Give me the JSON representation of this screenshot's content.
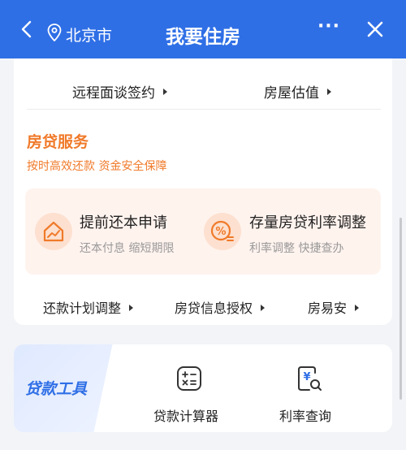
{
  "header": {
    "city": "北京市",
    "title": "我要住房",
    "more_label": "···"
  },
  "quick_links": [
    {
      "label": "远程面谈签约"
    },
    {
      "label": "房屋估值"
    }
  ],
  "mortgage": {
    "title": "房贷服务",
    "subtitle": "按时高效还款 资金安全保障",
    "services": [
      {
        "title": "提前还本申请",
        "subtitle": "还本付息 缩短期限"
      },
      {
        "title": "存量房贷利率调整",
        "subtitle": "利率调整 快捷查办"
      }
    ],
    "links": [
      {
        "label": "还款计划调整"
      },
      {
        "label": "房贷信息授权"
      },
      {
        "label": "房易安"
      }
    ]
  },
  "loan_tools": {
    "title": "贷款工具",
    "items": [
      {
        "label": "贷款计算器"
      },
      {
        "label": "利率查询"
      }
    ]
  },
  "colors": {
    "header_blue": "#2f6fe6",
    "accent_orange": "#f07a2a"
  }
}
